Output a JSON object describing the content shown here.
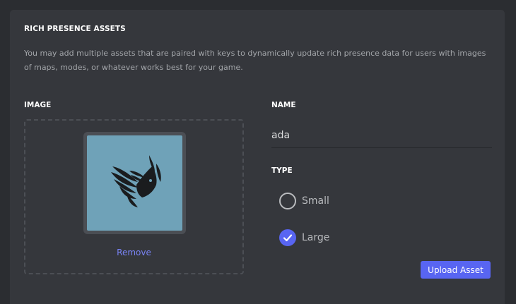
{
  "section": {
    "title": "RICH PRESENCE ASSETS",
    "description": "You may add multiple assets that are paired with keys to dynamically update rich presence data for users with images of maps, modes, or whatever works best for your game."
  },
  "image": {
    "label": "IMAGE",
    "remove_label": "Remove",
    "icon": "bird-logo",
    "background_color": "#6fa2b8"
  },
  "name": {
    "label": "NAME",
    "value": "ada"
  },
  "type": {
    "label": "TYPE",
    "options": [
      {
        "label": "Small",
        "selected": false
      },
      {
        "label": "Large",
        "selected": true
      }
    ]
  },
  "upload_button": {
    "label": "Upload Asset"
  },
  "colors": {
    "accent": "#5865f2",
    "link": "#7983f5",
    "panel": "#35373c"
  }
}
